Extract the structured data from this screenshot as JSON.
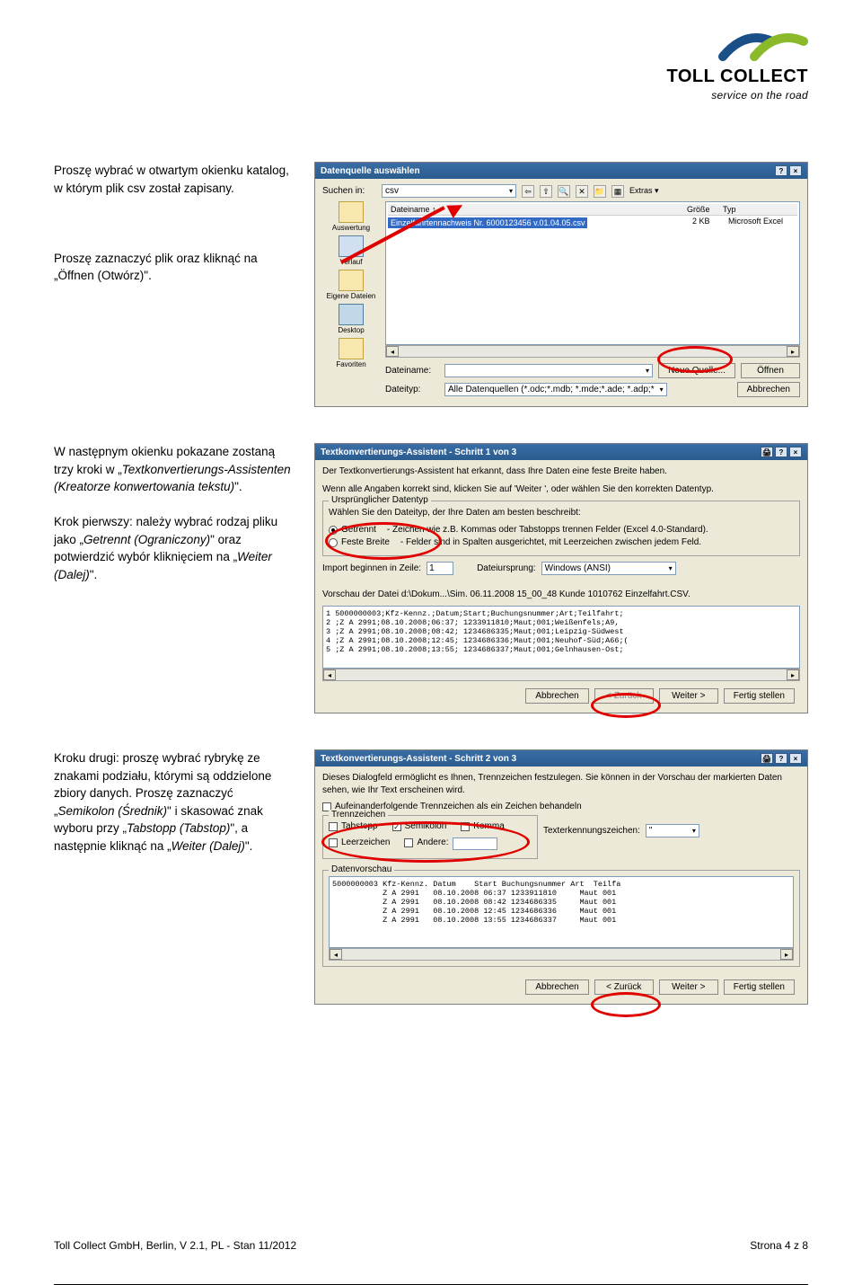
{
  "logo": {
    "title": "TOLL COLLECT",
    "sub": "service on the road"
  },
  "section1": {
    "text1": "Proszę wybrać w otwartym okienku katalog, w którym plik csv został zapisany.",
    "text2": "Proszę zaznaczyć plik oraz kliknąć na „Öffnen (Otwórz)\"."
  },
  "dlg1": {
    "title": "Datenquelle auswählen",
    "lookin_label": "Suchen in:",
    "lookin_value": "csv",
    "extras": "Extras ▾",
    "places": [
      "Auswertung",
      "Verlauf",
      "Eigene Dateien",
      "Desktop",
      "Favoriten"
    ],
    "col_name": "Dateiname ↑",
    "col_size": "Größe",
    "col_type": "Typ",
    "file_sel": "Einzelfahrtennachweis Nr. 6000123456 v.01.04.05.csv",
    "file_size": "2 KB",
    "file_type": "Microsoft Excel",
    "filename_label": "Dateiname:",
    "filetype_label": "Dateityp:",
    "filetype_value": "Alle Datenquellen (*.odc;*.mdb; *.mde;*.ade; *.adp;*",
    "btn_newsource": "Neue Quelle...",
    "btn_open": "Öffnen",
    "btn_cancel": "Abbrechen"
  },
  "section2": {
    "text1": "W następnym okienku pokazane zostaną trzy kroki w „Textkonvertierungs-Assistenten (Kreatorze konwertowania tekstu)\".",
    "text2": "Krok pierwszy: należy wybrać rodzaj pliku jako „Getrennt (Ograniczony)\" oraz potwierdzić wybór kliknięciem na „Weiter (Dalej)\"."
  },
  "dlg2": {
    "title": "Textkonvertierungs-Assistent - Schritt 1 von 3",
    "desc1": "Der Textkonvertierungs-Assistent hat erkannt, dass Ihre Daten eine feste Breite haben.",
    "desc2": "Wenn alle Angaben korrekt sind, klicken Sie auf 'Weiter ', oder wählen Sie den korrekten Datentyp.",
    "group_type": "Ursprünglicher Datentyp",
    "type_label": "Wählen Sie den Dateityp, der Ihre Daten am besten beschreibt:",
    "opt_delim": "Getrennt",
    "opt_delim_desc": "- Zeichen wie z.B. Kommas oder Tabstopps trennen Felder (Excel 4.0-Standard).",
    "opt_fixed": "Feste Breite",
    "opt_fixed_desc": "- Felder sind in Spalten ausgerichtet, mit Leerzeichen zwischen jedem Feld.",
    "startrow_label": "Import beginnen in Zeile:",
    "startrow_value": "1",
    "origin_label": "Dateiursprung:",
    "origin_value": "Windows (ANSI)",
    "preview_label": "Vorschau der Datei d:\\Dokum...\\Sim. 06.11.2008 15_00_48 Kunde 1010762 Einzelfahrt.CSV.",
    "preview": "1 5000000003;Kfz-Kennz.;Datum;Start;Buchungsnummer;Art;Teilfahrt;\n2 ;Z A 2991;08.10.2008;06:37; 1233911810;Maut;001;Weißenfels;A9,\n3 ;Z A 2991;08.10.2008;08:42; 1234686335;Maut;001;Leipzig-Südwest\n4 ;Z A 2991;08.10.2008;12:45; 1234686336;Maut;001;Neuhof-Süd;A66;(\n5 ;Z A 2991;08.10.2008;13:55; 1234686337;Maut;001;Gelnhausen-Ost;",
    "btn_cancel": "Abbrechen",
    "btn_back": "< Zurück",
    "btn_next": "Weiter >",
    "btn_finish": "Fertig stellen"
  },
  "section3": {
    "text": "Kroku drugi: proszę wybrać rybrykę ze znakami podziału, którymi są oddzielone zbiory danych. Proszę zaznaczyć „Semikolon (Średnik)\" i skasować znak wyboru przy „Tabstopp (Tabstop)\", a następnie kliknąć na „Weiter (Dalej)\"."
  },
  "dlg3": {
    "title": "Textkonvertierungs-Assistent - Schritt 2 von 3",
    "desc1": "Dieses Dialogfeld ermöglicht es Ihnen, Trennzeichen festzulegen. Sie können in der Vorschau der markierten Daten sehen, wie Ihr Text erscheinen wird.",
    "opt_consec": "Aufeinanderfolgende Trennzeichen als ein Zeichen behandeln",
    "group_sep": "Trennzeichen",
    "cb_tab": "Tabstopp",
    "cb_semi": "Semikolon",
    "cb_comma": "Komma",
    "cb_space": "Leerzeichen",
    "cb_other": "Andere:",
    "textqual_label": "Texterkennungszeichen:",
    "textqual_value": "\"",
    "group_preview": "Datenvorschau",
    "preview_header": "5000000003 Kfz-Kennz. Datum    Start Buchungsnummer Art  Teilfa",
    "preview": "           Z A 2991   08.10.2008 06:37 1233911810     Maut 001\n           Z A 2991   08.10.2008 08:42 1234686335     Maut 001\n           Z A 2991   08.10.2008 12:45 1234686336     Maut 001\n           Z A 2991   08.10.2008 13:55 1234686337     Maut 001",
    "btn_cancel": "Abbrechen",
    "btn_back": "< Zurück",
    "btn_next": "Weiter >",
    "btn_finish": "Fertig stellen"
  },
  "footer": {
    "left": "Toll Collect GmbH, Berlin, V 2.1, PL - Stan 11/2012",
    "right": "Strona 4 z 8"
  }
}
